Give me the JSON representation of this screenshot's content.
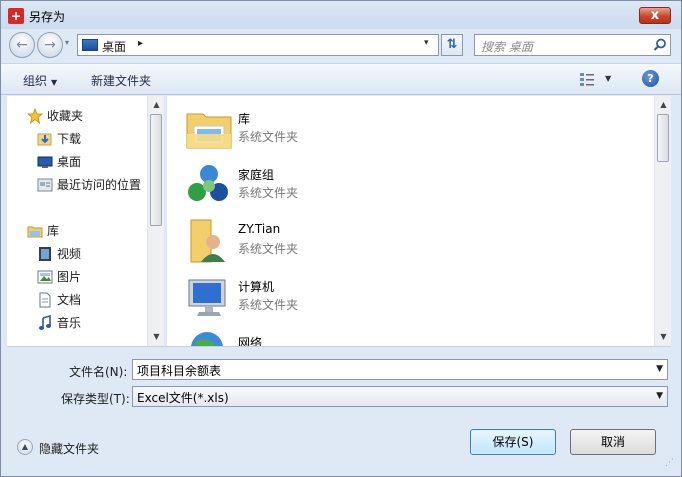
{
  "window": {
    "title": "另存为",
    "app_icon_glyph": "+",
    "close_glyph": "x"
  },
  "nav": {
    "back_glyph": "←",
    "forward_glyph": "→",
    "history_glyph": "▾",
    "address_segment": "桌面",
    "address_arrow": "▸",
    "address_dropdown": "▾",
    "refresh_glyph": "⇅",
    "search_placeholder": "搜索 桌面"
  },
  "toolbar": {
    "organize": "组织",
    "organize_caret": "▼",
    "new_folder": "新建文件夹",
    "view_caret": "▼",
    "help_glyph": "?"
  },
  "sidebar": {
    "items": [
      {
        "label": "收藏夹",
        "icon": "star-icon"
      },
      {
        "label": "下载",
        "icon": "download-folder-icon"
      },
      {
        "label": "桌面",
        "icon": "desktop-icon"
      },
      {
        "label": "最近访问的位置",
        "icon": "recent-places-icon"
      },
      {
        "label": "库",
        "icon": "library-icon"
      },
      {
        "label": "视频",
        "icon": "video-icon"
      },
      {
        "label": "图片",
        "icon": "pictures-icon"
      },
      {
        "label": "文档",
        "icon": "documents-icon"
      },
      {
        "label": "音乐",
        "icon": "music-icon"
      }
    ],
    "scroll_up": "▲",
    "scroll_down": "▼"
  },
  "files": {
    "items": [
      {
        "name": "库",
        "type": "系统文件夹",
        "icon": "libraries-folder-icon"
      },
      {
        "name": "家庭组",
        "type": "系统文件夹",
        "icon": "homegroup-icon"
      },
      {
        "name": "ZY.Tian",
        "type": "系统文件夹",
        "icon": "user-folder-icon"
      },
      {
        "name": "计算机",
        "type": "系统文件夹",
        "icon": "computer-icon"
      },
      {
        "name": "网络",
        "type": "",
        "icon": "network-icon"
      }
    ],
    "scroll_up": "▲",
    "scroll_down": "▼"
  },
  "form": {
    "filename_label": "文件名(N):",
    "filename_value": "项目科目余额表",
    "filetype_label": "保存类型(T):",
    "filetype_value": "Excel文件(*.xls)",
    "combo_caret": "▼"
  },
  "footer": {
    "hide_folders": "隐藏文件夹",
    "hide_caret": "▲",
    "save": "保存(S)",
    "cancel": "取消"
  },
  "colors": {
    "dialog_bg": "#dfe9f5",
    "close_red": "#c8452e",
    "accent_blue": "#3c7fb1"
  }
}
